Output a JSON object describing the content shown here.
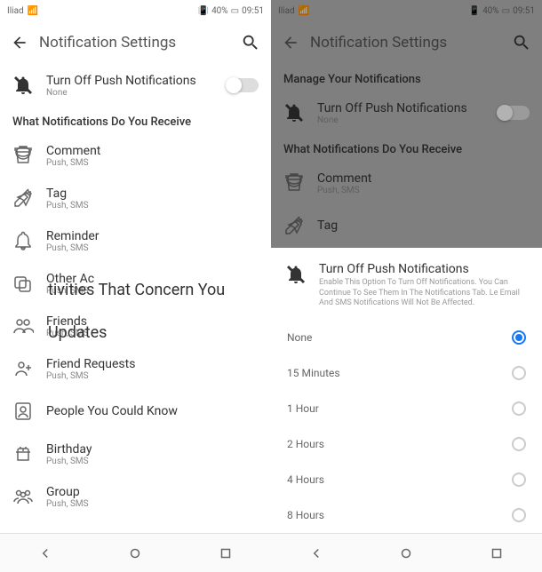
{
  "status": {
    "carrier": "Iliad",
    "battery": "40%",
    "time": "09:51",
    "vibrate": "📳"
  },
  "header": {
    "title": "Notification Settings"
  },
  "manage_caption": "Manage Your Notifications",
  "push_off": {
    "title": "Turn Off Push Notifications",
    "sub": "None"
  },
  "section_what": "What Notifications Do You Receive",
  "items": [
    {
      "title": "Comment",
      "sub": "Push, SMS"
    },
    {
      "title": "Tag",
      "sub": "Push, SMS"
    },
    {
      "title": "Reminder",
      "sub": "Push, SMS"
    },
    {
      "title": "Other Ac",
      "sub": "Push, SMS"
    },
    {
      "title": "Friends",
      "sub": "Push, SMS"
    },
    {
      "title": "Friend Requests",
      "sub": "Push, SMS"
    },
    {
      "title": "People You Could Know",
      "sub": ""
    },
    {
      "title": "Birthday",
      "sub": "Push, SMS"
    },
    {
      "title": "Group",
      "sub": "Push, SMS"
    }
  ],
  "overlays": {
    "line1": "tivities That Concern You",
    "line2": "Updates"
  },
  "sheet": {
    "title": "Turn Off Push Notifications",
    "desc": "Enable This Option To Turn Off Notifications. You Can Continue To See Them In The Notifications Tab. Le Email And SMS Notifications Will Not Be Affected.",
    "options": [
      {
        "label": "None",
        "selected": true
      },
      {
        "label": "15 Minutes",
        "selected": false
      },
      {
        "label": "1 Hour",
        "selected": false
      },
      {
        "label": "2 Hours",
        "selected": false
      },
      {
        "label": "4 Hours",
        "selected": false
      },
      {
        "label": "8 Hours",
        "selected": false
      }
    ]
  },
  "right_items": [
    {
      "title": "Comment",
      "sub": "Push, SMS"
    },
    {
      "title": "Tag",
      "sub": ""
    }
  ]
}
